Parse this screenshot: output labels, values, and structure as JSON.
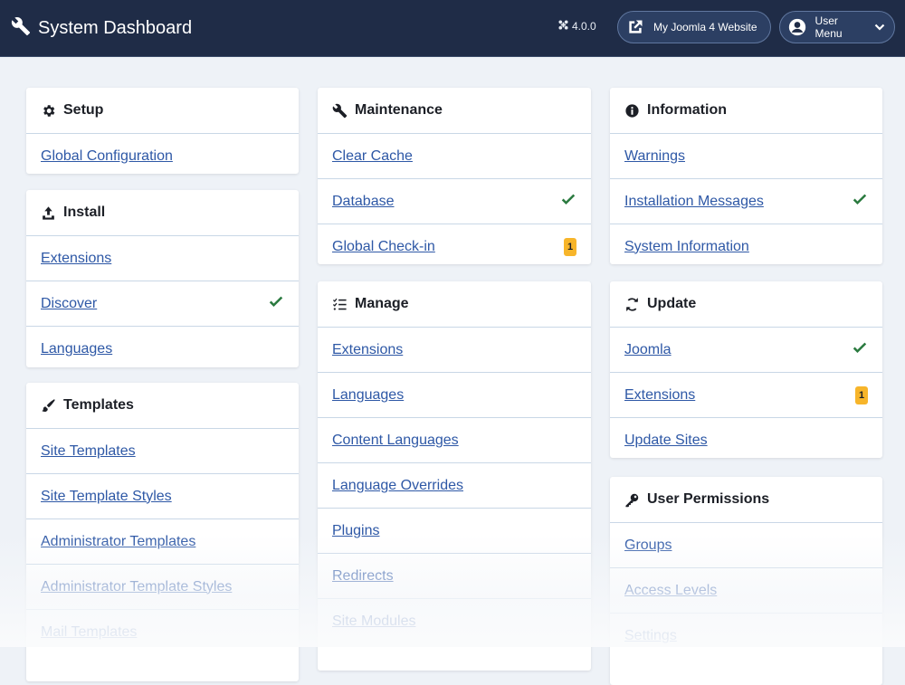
{
  "header": {
    "title": "System Dashboard",
    "version": "4.0.0",
    "site_button": "My Joomla 4 Website",
    "user_button": "User Menu"
  },
  "colors": {
    "header_bg": "#1f2c47",
    "link": "#2e58a6",
    "check": "#2a7a3f",
    "badge": "#f7b52a"
  },
  "cards": {
    "setup": {
      "title": "Setup",
      "items": [
        {
          "label": "Global Configuration"
        }
      ]
    },
    "install": {
      "title": "Install",
      "items": [
        {
          "label": "Extensions"
        },
        {
          "label": "Discover",
          "status": "check"
        },
        {
          "label": "Languages"
        }
      ]
    },
    "templates": {
      "title": "Templates",
      "items": [
        {
          "label": "Site Templates"
        },
        {
          "label": "Site Template Styles"
        },
        {
          "label": "Administrator Templates"
        },
        {
          "label": "Administrator Template Styles"
        },
        {
          "label": "Mail Templates"
        }
      ]
    },
    "maintenance": {
      "title": "Maintenance",
      "items": [
        {
          "label": "Clear Cache"
        },
        {
          "label": "Database",
          "status": "check"
        },
        {
          "label": "Global Check-in",
          "badge": "1"
        }
      ]
    },
    "manage": {
      "title": "Manage",
      "items": [
        {
          "label": "Extensions"
        },
        {
          "label": "Languages"
        },
        {
          "label": "Content Languages"
        },
        {
          "label": "Language Overrides"
        },
        {
          "label": "Plugins"
        },
        {
          "label": "Redirects"
        },
        {
          "label": "Site Modules"
        }
      ]
    },
    "information": {
      "title": "Information",
      "items": [
        {
          "label": "Warnings"
        },
        {
          "label": "Installation Messages",
          "status": "check"
        },
        {
          "label": "System Information"
        }
      ]
    },
    "update": {
      "title": "Update",
      "items": [
        {
          "label": "Joomla",
          "status": "check"
        },
        {
          "label": "Extensions",
          "badge": "1"
        },
        {
          "label": "Update Sites"
        }
      ]
    },
    "permissions": {
      "title": "User Permissions",
      "items": [
        {
          "label": "Groups"
        },
        {
          "label": "Access Levels"
        },
        {
          "label": "Settings"
        }
      ]
    }
  }
}
